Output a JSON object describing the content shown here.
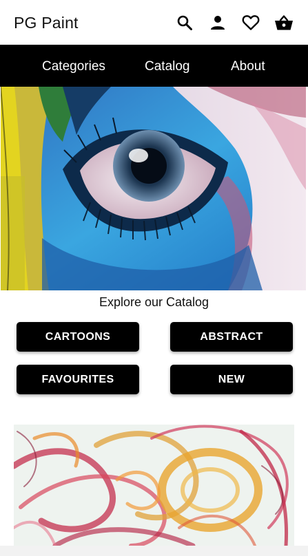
{
  "header": {
    "brand": "PG Paint",
    "icons": [
      "search-icon",
      "user-icon",
      "heart-icon",
      "basket-icon"
    ]
  },
  "nav": {
    "items": [
      {
        "label": "Categories"
      },
      {
        "label": "Catalog"
      },
      {
        "label": "About"
      }
    ]
  },
  "main": {
    "explore_heading": "Explore our Catalog",
    "category_buttons": [
      {
        "label": "CARTOONS"
      },
      {
        "label": "ABSTRACT"
      },
      {
        "label": "FAVOURITES"
      },
      {
        "label": "NEW"
      }
    ]
  },
  "colors": {
    "nav_background": "#000000",
    "button_background": "#000000",
    "button_text": "#ffffff"
  }
}
